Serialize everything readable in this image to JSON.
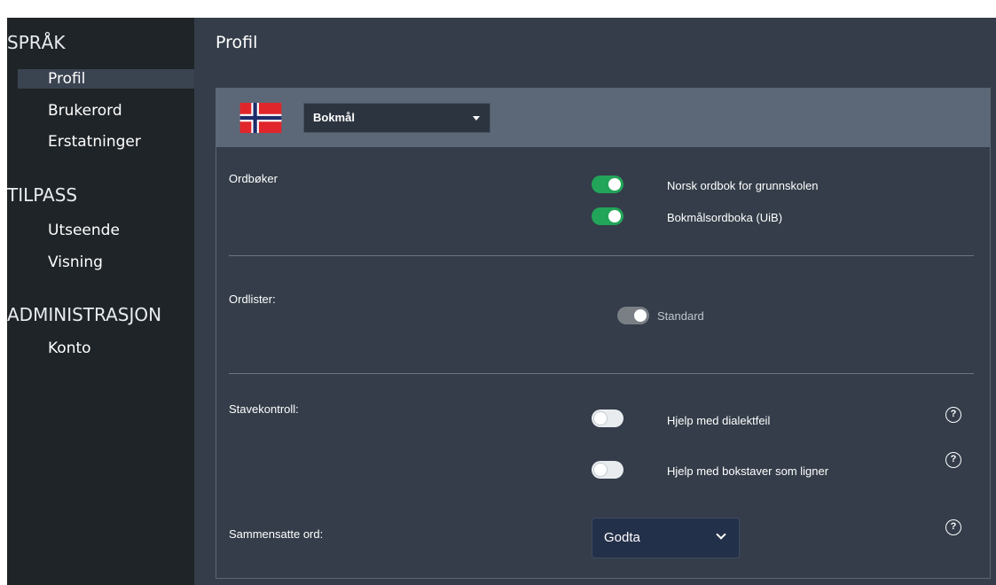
{
  "sidebar": {
    "sections": [
      {
        "title": "SPRÅK",
        "items": [
          "Profil",
          "Brukerord",
          "Erstatninger"
        ]
      },
      {
        "title": "TILPASS",
        "items": [
          "Utseende",
          "Visning"
        ]
      },
      {
        "title": "ADMINISTRASJON",
        "items": [
          "Konto"
        ]
      }
    ],
    "active_item": "Profil"
  },
  "page": {
    "title": "Profil"
  },
  "language": {
    "selected": "Bokmål",
    "flag": "norway-flag-icon"
  },
  "dictionaries": {
    "label": "Ordbøker",
    "options": [
      {
        "label": "Norsk ordbok for grunnskolen",
        "enabled": true
      },
      {
        "label": "Bokmålsordboka (UiB)",
        "enabled": true
      }
    ]
  },
  "wordlists": {
    "label": "Ordlister:",
    "options": [
      {
        "label": "Standard",
        "enabled": true,
        "disabled": true
      }
    ]
  },
  "spellcheck": {
    "label": "Stavekontroll:",
    "options": [
      {
        "label": "Hjelp med dialektfeil",
        "enabled": false
      },
      {
        "label": "Hjelp med bokstaver som ligner",
        "enabled": false
      }
    ]
  },
  "compound": {
    "label": "Sammensatte ord:",
    "selected": "Godta"
  },
  "icons": {
    "help": "?"
  },
  "colors": {
    "sidebar_bg": "#1f2428",
    "main_bg": "#343d49",
    "toggle_on": "#22a559",
    "header_bg": "#5c6878"
  }
}
